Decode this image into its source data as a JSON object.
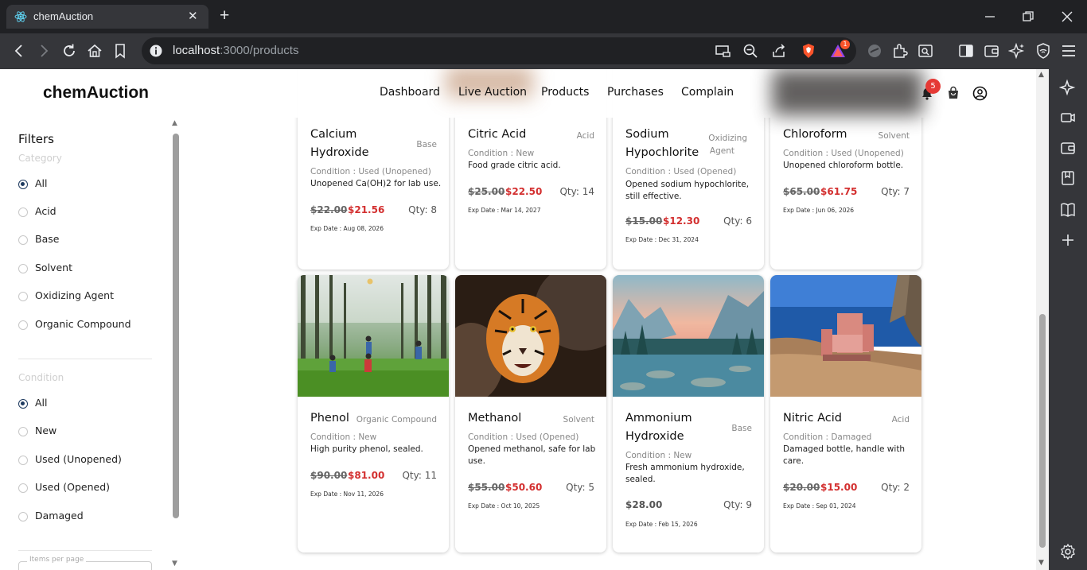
{
  "browser": {
    "tab_title": "chemAuction",
    "tab_close": "✕",
    "new_tab": "+",
    "url_host": "localhost",
    "url_path": ":3000/products",
    "brave_rewards_badge": "1"
  },
  "app": {
    "brand": "chemAuction",
    "nav": [
      "Dashboard",
      "Live Auction",
      "Products",
      "Purchases",
      "Complain"
    ],
    "notification_count": "5"
  },
  "filters": {
    "title": "Filters",
    "category_label": "Category",
    "categories": [
      "All",
      "Acid",
      "Base",
      "Solvent",
      "Oxidizing Agent",
      "Organic Compound"
    ],
    "category_selected": "All",
    "condition_label": "Condition",
    "conditions": [
      "All",
      "New",
      "Used (Unopened)",
      "Used (Opened)",
      "Damaged"
    ],
    "condition_selected": "All",
    "items_per_page_label": "Items per page"
  },
  "products": [
    {
      "name_l1": "Calcium",
      "name_l2": "Hydroxide",
      "category": "Base",
      "condition": "Condition : Used (Unopened)",
      "description": "Unopened Ca(OH)2 for lab use.",
      "old_price": "$22.00",
      "price": "$21.56",
      "qty": "Qty: 8",
      "exp": "Exp Date : Aug 08, 2026"
    },
    {
      "name_l1": "Citric Acid",
      "name_l2": "",
      "category": "Acid",
      "condition": "Condition : New",
      "description": "Food grade citric acid.",
      "old_price": "$25.00",
      "price": "$22.50",
      "qty": "Qty: 14",
      "exp": "Exp Date : Mar 14, 2027"
    },
    {
      "name_l1": "Sodium",
      "name_l2": "Hypochlorite",
      "category_l1": "Oxidizing",
      "category_l2": "Agent",
      "condition": "Condition : Used (Opened)",
      "description": "Opened sodium hypochlorite, still effective.",
      "old_price": "$15.00",
      "price": "$12.30",
      "qty": "Qty: 6",
      "exp": "Exp Date : Dec 31, 2024"
    },
    {
      "name_l1": "Chloroform",
      "name_l2": "",
      "category": "Solvent",
      "condition": "Condition : Used (Unopened)",
      "description": "Unopened chloroform bottle.",
      "old_price": "$65.00",
      "price": "$61.75",
      "qty": "Qty: 7",
      "exp": "Exp Date : Jun 06, 2026"
    },
    {
      "name_l1": "Phenol",
      "name_l2": "",
      "category": "Organic Compound",
      "condition": "Condition : New",
      "description": "High purity phenol, sealed.",
      "old_price": "$90.00",
      "price": "$81.00",
      "qty": "Qty: 11",
      "exp": "Exp Date : Nov 11, 2026",
      "image": "children-playing-in-forest"
    },
    {
      "name_l1": "Methanol",
      "name_l2": "",
      "category": "Solvent",
      "condition": "Condition : Used (Opened)",
      "description": "Opened methanol, safe for lab use.",
      "old_price": "$55.00",
      "price": "$50.60",
      "qty": "Qty: 5",
      "exp": "Exp Date : Oct 10, 2025",
      "image": "tiger"
    },
    {
      "name_l1": "Ammonium",
      "name_l2": "Hydroxide",
      "category": "Base",
      "condition": "Condition : New",
      "description": "Fresh ammonium hydroxide, sealed.",
      "old_price": "",
      "price": "$28.00",
      "qty": "Qty: 9",
      "exp": "Exp Date : Feb 15, 2026",
      "image": "mountain-lake"
    },
    {
      "name_l1": "Nitric Acid",
      "name_l2": "",
      "category": "Acid",
      "condition": "Condition : Damaged",
      "description": "Damaged bottle, handle with care.",
      "old_price": "$20.00",
      "price": "$15.00",
      "qty": "Qty: 2",
      "exp": "Exp Date : Sep 01, 2024",
      "image": "armchair-on-beach"
    }
  ],
  "colors": {
    "price_red": "#d32f2f",
    "radio_selected": "#1e3a5f",
    "badge_red": "#e53935"
  }
}
